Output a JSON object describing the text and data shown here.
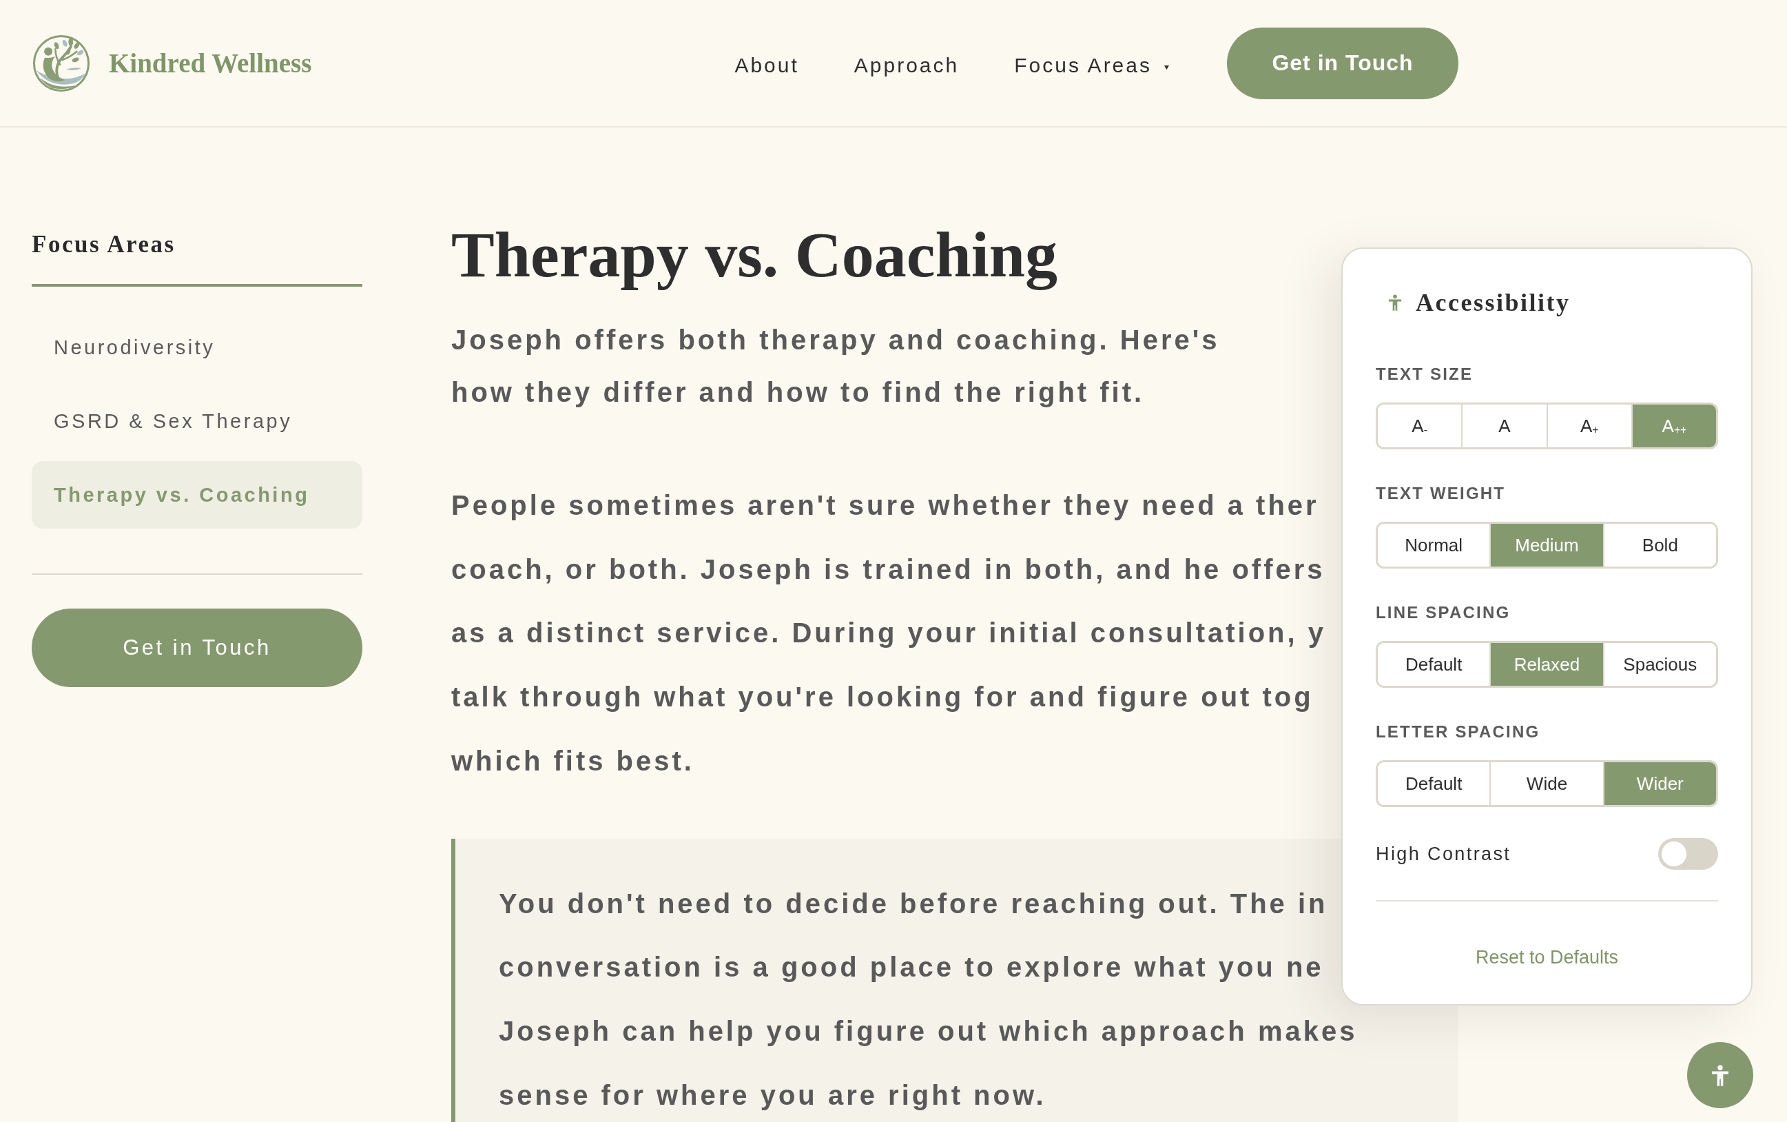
{
  "header": {
    "logo_text": "Kindred Wellness",
    "nav": [
      {
        "label": "About",
        "kind": "link"
      },
      {
        "label": "Approach",
        "kind": "link"
      },
      {
        "label": "Focus Areas",
        "kind": "dropdown"
      }
    ],
    "cta": "Get in Touch"
  },
  "sidebar": {
    "title": "Focus Areas",
    "items": [
      {
        "label": "Neurodiversity",
        "selected": false
      },
      {
        "label": "GSRD & Sex Therapy",
        "selected": false
      },
      {
        "label": "Therapy vs. Coaching",
        "selected": true
      }
    ],
    "cta": "Get in Touch"
  },
  "article": {
    "title": "Therapy vs. Coaching",
    "intro": "Joseph offers both therapy and coaching. Here's how they differ and how to find the right fit.",
    "body_lines": [
      "People sometimes aren't sure whether they need a ther",
      "coach, or both. Joseph is trained in both, and he offers",
      "as a distinct service. During your initial consultation, y",
      "talk through what you're looking for and figure out tog",
      "which fits best."
    ],
    "callout_lines": [
      "You don't need to decide before reaching out. The in",
      "conversation is a good place to explore what you ne",
      "Joseph can help you figure out which approach makes",
      "sense for where you are right now."
    ]
  },
  "accessibility_panel": {
    "title": "Accessibility",
    "settings": [
      {
        "label": "TEXT SIZE",
        "options": [
          {
            "label": "A$_{-}$",
            "selected": false
          },
          {
            "label": "A",
            "selected": false
          },
          {
            "label": "A$_{+}$",
            "selected": false
          },
          {
            "label": "A$_{++}$",
            "selected": true
          }
        ]
      },
      {
        "label": "TEXT WEIGHT",
        "options": [
          {
            "label": "Normal",
            "selected": false
          },
          {
            "label": "Medium",
            "selected": true
          },
          {
            "label": "Bold",
            "selected": false
          }
        ]
      },
      {
        "label": "LINE SPACING",
        "options": [
          {
            "label": "Default",
            "selected": false
          },
          {
            "label": "Relaxed",
            "selected": true
          },
          {
            "label": "Spacious",
            "selected": false
          }
        ]
      },
      {
        "label": "LETTER SPACING",
        "options": [
          {
            "label": "Default",
            "selected": false
          },
          {
            "label": "Wide",
            "selected": false
          },
          {
            "label": "Wider",
            "selected": true
          }
        ]
      }
    ],
    "high_contrast": {
      "label": "High Contrast",
      "on": false
    },
    "reset": "Reset to Defaults"
  }
}
